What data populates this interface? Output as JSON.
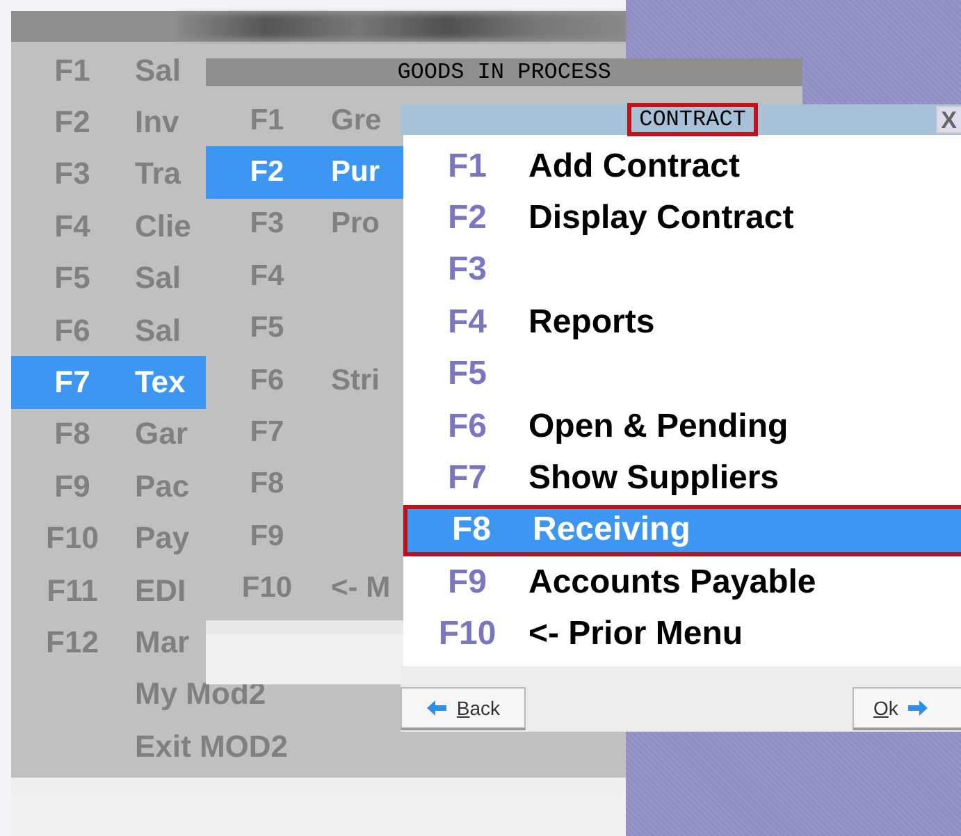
{
  "windows": [
    {
      "kind": "menu",
      "has_title": false,
      "items": [
        {
          "key": "F1",
          "label": "Sal",
          "selected": false
        },
        {
          "key": "F2",
          "label": "Inv",
          "selected": false
        },
        {
          "key": "F3",
          "label": "Tra",
          "selected": false
        },
        {
          "key": "F4",
          "label": "Clie",
          "selected": false
        },
        {
          "key": "F5",
          "label": "Sal",
          "selected": false
        },
        {
          "key": "F6",
          "label": "Sal",
          "selected": false
        },
        {
          "key": "F7",
          "label": "Tex",
          "selected": true
        },
        {
          "key": "F8",
          "label": "Gar",
          "selected": false
        },
        {
          "key": "F9",
          "label": "Pac",
          "selected": false
        },
        {
          "key": "F10",
          "label": "Pay",
          "selected": false
        },
        {
          "key": "F11",
          "label": "EDI",
          "selected": false
        },
        {
          "key": "F12",
          "label": "Mar",
          "selected": false
        },
        {
          "label": "My Mod2",
          "selected": false
        },
        {
          "label": "Exit MOD2",
          "selected": false
        }
      ]
    },
    {
      "kind": "menu",
      "title": "GOODS IN PROCESS",
      "items": [
        {
          "key": "F1",
          "label": "Gre",
          "selected": false
        },
        {
          "key": "F2",
          "label": "Pur",
          "selected": true
        },
        {
          "key": "F3",
          "label": "Pro",
          "selected": false
        },
        {
          "key": "F4",
          "selected": false
        },
        {
          "key": "F5",
          "selected": false
        },
        {
          "key": "F6",
          "label": "Stri",
          "selected": false
        },
        {
          "key": "F7",
          "selected": false
        },
        {
          "key": "F8",
          "selected": false
        },
        {
          "key": "F9",
          "selected": false
        },
        {
          "key": "F10",
          "label": "<- M",
          "selected": false
        }
      ]
    },
    {
      "kind": "dialog",
      "title": "CONTRACT",
      "title_outlined": true,
      "close": "X",
      "items": [
        {
          "key": "F1",
          "label": "Add Contract",
          "selected": false,
          "outlined": false
        },
        {
          "key": "F2",
          "label": "Display Contract",
          "selected": false,
          "outlined": false
        },
        {
          "key": "F3",
          "selected": false,
          "outlined": false
        },
        {
          "key": "F4",
          "label": "Reports",
          "selected": false,
          "outlined": false
        },
        {
          "key": "F5",
          "selected": false,
          "outlined": false
        },
        {
          "key": "F6",
          "label": "Open & Pending",
          "selected": false,
          "outlined": false
        },
        {
          "key": "F7",
          "label": "Show Suppliers",
          "selected": false,
          "outlined": false
        },
        {
          "key": "F8",
          "label": "Receiving",
          "selected": true,
          "outlined": true
        },
        {
          "key": "F9",
          "label": "Accounts Payable",
          "selected": false,
          "outlined": false
        },
        {
          "key": "F10",
          "label": "<- Prior Menu",
          "selected": false,
          "outlined": false
        }
      ],
      "buttons": [
        {
          "kind": "back",
          "label": "Back"
        },
        {
          "kind": "ok",
          "label": "Ok"
        }
      ]
    }
  ]
}
